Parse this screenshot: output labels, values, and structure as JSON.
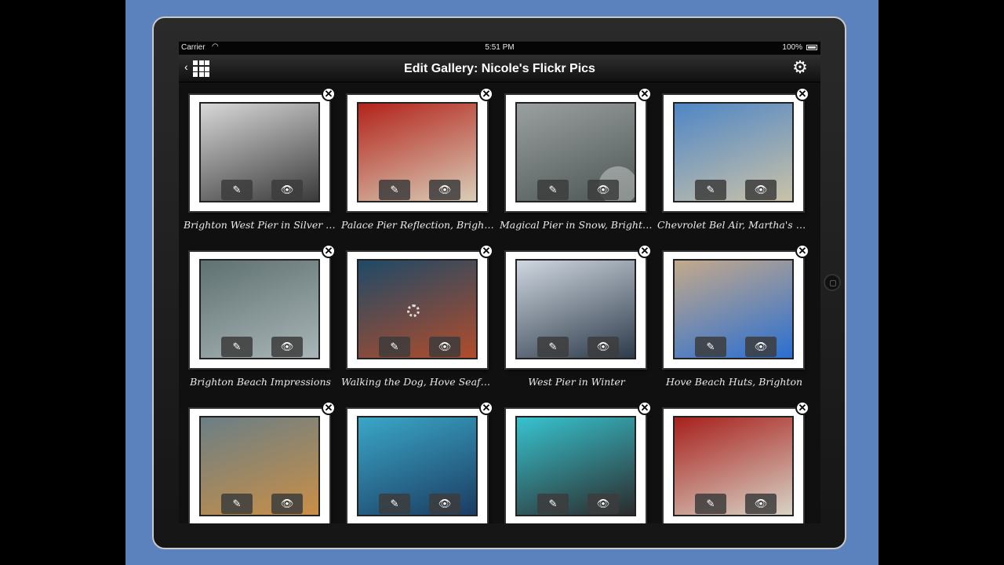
{
  "statusbar": {
    "carrier": "Carrier",
    "time": "5:51 PM",
    "battery": "100%"
  },
  "navbar": {
    "title": "Edit Gallery: Nicole's Flickr Pics"
  },
  "icons": {
    "chevron": "‹",
    "gear": "⚙",
    "edit": "✎",
    "view": "👁",
    "delete": "✕",
    "wifi": "◠"
  },
  "items": [
    {
      "caption": "Brighton West Pier in Silver Cl...",
      "colors": [
        "#d8d8d8",
        "#3a3a3a"
      ]
    },
    {
      "caption": "Palace Pier Reflection, Brighton",
      "colors": [
        "#b3231a",
        "#d9cdb8"
      ]
    },
    {
      "caption": "Magical Pier in Snow, Brighton",
      "colors": [
        "#9aa0a0",
        "#4d5654"
      ]
    },
    {
      "caption": "Chevrolet Bel Air, Martha's Vin...",
      "colors": [
        "#4f86c6",
        "#c9c2a8"
      ]
    },
    {
      "caption": "Brighton Beach Impressions",
      "colors": [
        "#5f7170",
        "#a9b5b8"
      ]
    },
    {
      "caption": "Walking the Dog, Hove Seafront",
      "colors": [
        "#1f4a67",
        "#b14c2b"
      ]
    },
    {
      "caption": "West Pier in Winter",
      "colors": [
        "#cfd7e0",
        "#2d3b4a"
      ]
    },
    {
      "caption": "Hove Beach Huts, Brighton",
      "colors": [
        "#c4a98c",
        "#2a6fd1"
      ]
    },
    {
      "caption": "",
      "colors": [
        "#6b7f86",
        "#c98f46"
      ]
    },
    {
      "caption": "",
      "colors": [
        "#3aa7c8",
        "#1b3c62"
      ]
    },
    {
      "caption": "",
      "colors": [
        "#37c3cf",
        "#2b2b2b"
      ]
    },
    {
      "caption": "",
      "colors": [
        "#a8201c",
        "#d8d3c6"
      ]
    }
  ]
}
